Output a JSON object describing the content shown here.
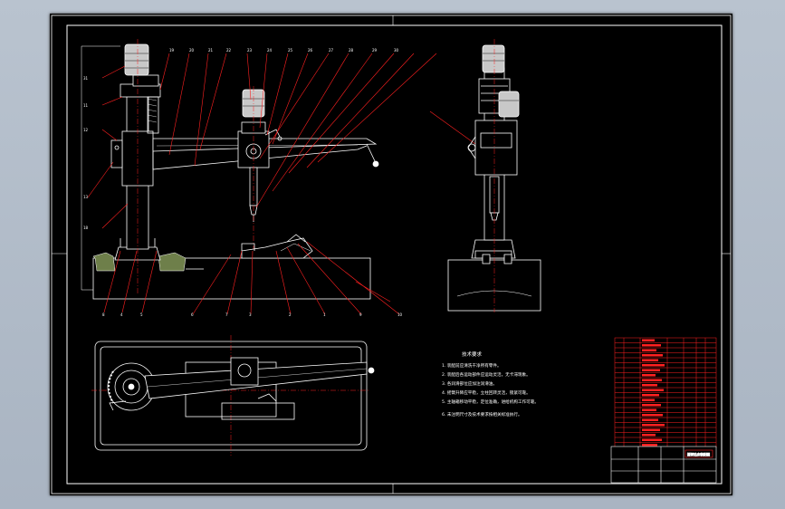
{
  "title_block_colors": {
    "frame": "#ffffff",
    "leader": "#ff2020",
    "table": "#ff2020",
    "machine": "#ffffff",
    "motor_grey": "#c8c8c8",
    "base_green": "#6e7f4a"
  },
  "balloons_top": [
    "31",
    "11",
    "12",
    "13",
    "18",
    "19",
    "20",
    "21",
    "22",
    "23",
    "24",
    "25",
    "26",
    "27",
    "28",
    "29",
    "30"
  ],
  "balloons_bottom": [
    "8",
    "4",
    "5",
    "6",
    "7",
    "3",
    "2",
    "1",
    "9",
    "10"
  ],
  "tech_notes": {
    "heading": "技术要求",
    "lines": [
      "1. 装配前应清洗干净所有零件。",
      "2. 装配后各运动部件应运动灵活，无卡滞现象。",
      "3. 各润滑部位应加注润滑油。",
      "4. 摇臂升降应平稳，立柱回转灵活，锁紧可靠。",
      "5. 主轴箱移动平稳，定位准确，进给机构工作可靠。",
      "6. 未注明尺寸及技术要求按相关标准执行。"
    ]
  },
  "parts_table": {
    "rows": 22,
    "cols": 7
  },
  "title_block_label": "摇臂钻床装配图"
}
